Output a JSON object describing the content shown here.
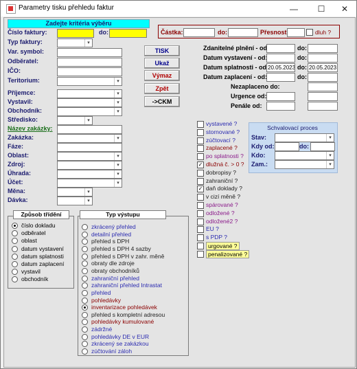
{
  "window": {
    "title": "Parametry tisku přehledu faktur",
    "minimize": "—",
    "maximize": "☐",
    "close": "✕"
  },
  "criteria_header": "Zadejte kritéria výběru",
  "left_fields": {
    "cislo_faktury": "Číslo faktury:",
    "do": "do:",
    "typ_faktury": "Typ faktury:",
    "var_symbol": "Var. symbol:",
    "odberatel": "Odběratel:",
    "ico": "IČO:",
    "teritorium": "Teritorium:",
    "prijemce": "Příjemce:",
    "vystavil": "Vystavil:",
    "obchodnik": "Obchodník:",
    "stredisko": "Středisko:",
    "nazev_zakazky": "Název zakázky:",
    "zakazka": "Zakázka:",
    "faze": "Fáze:",
    "oblast": "Oblast:",
    "zdroj": "Zdroj:",
    "uhrada": "Úhrada:",
    "ucet": "Účet:",
    "mena": "Měna:",
    "davka": "Dávka:"
  },
  "amount": {
    "castka": "Částka:",
    "do": "do:",
    "presnost": "Přesnost:",
    "dluh": "dluh ?"
  },
  "buttons": {
    "tisk": "TISK",
    "ukaz": "Ukaž",
    "vymaz": "Výmaz",
    "zpet": "Zpět",
    "ckm": "->CKM"
  },
  "dates": {
    "zdanitelne": "Zdanitelné plnění - od:",
    "vystaveni": "Datum vystavení - od:",
    "splatnosti": "Datum splatnosti - od:",
    "zaplaceni": "Datum zaplacení - od:",
    "do": "do:",
    "splatnost_od": "20.05.2023",
    "splatnost_do": "20.05.2023",
    "nezaplaceno": "Nezaplaceno do:",
    "urgence": "Urgence od:",
    "penale": "Penále od:"
  },
  "checks": [
    {
      "label": "vystavené ?",
      "checked": false,
      "color": "#2b2bb0"
    },
    {
      "label": "stornované ?",
      "checked": false,
      "color": "#2b2bb0"
    },
    {
      "label": "zúčtovací ?",
      "checked": false,
      "color": "#2b2bb0"
    },
    {
      "label": "zaplacené ?",
      "checked": false,
      "color": "#8b0000"
    },
    {
      "label": "po splatnosti ?",
      "checked": false,
      "color": "#8a1a8a"
    },
    {
      "label": "dlužná č. > 0 ?",
      "checked": true,
      "color": "#8b0000"
    },
    {
      "label": "dobropisy ?",
      "checked": false,
      "color": "#222"
    },
    {
      "label": "zahraniční ?",
      "checked": false,
      "color": "#222"
    },
    {
      "label": "daň doklady ?",
      "checked": true,
      "color": "#222"
    },
    {
      "label": "v cizí měně ?",
      "checked": false,
      "color": "#222"
    },
    {
      "label": "spárované ?",
      "checked": false,
      "color": "#8a1a8a"
    },
    {
      "label": "odložené ?",
      "checked": false,
      "color": "#8a1a8a"
    },
    {
      "label": "odložené2 ?",
      "checked": false,
      "color": "#8a1a8a"
    },
    {
      "label": "EU ?",
      "checked": false,
      "color": "#2b2bb0"
    },
    {
      "label": "s PDP ?",
      "checked": false,
      "color": "#2b2bb0"
    },
    {
      "label": "urgované ?",
      "checked": false,
      "color": "#000"
    },
    {
      "label": "penalizované ?",
      "checked": false,
      "color": "#000"
    }
  ],
  "approval": {
    "title": "Schvalovací proces",
    "stav": "Stav:",
    "kdy_od": "Kdy od:",
    "do": "do:",
    "kdo": "Kdo:",
    "zam": "Zam.:"
  },
  "sort": {
    "title": "Způsob třídění",
    "items": [
      "číslo dokladu",
      "odběratel",
      "oblast",
      "datum vystavení",
      "datum splatnosti",
      "datum zaplacení",
      "vystavil",
      "obchodník"
    ],
    "selected": 0
  },
  "output": {
    "title": "Typ výstupu",
    "items": [
      {
        "label": "zkrácený přehled",
        "color": "#2b2bb0"
      },
      {
        "label": "detailní přehled",
        "color": "#2b2bb0"
      },
      {
        "label": "přehled s DPH",
        "color": "#222"
      },
      {
        "label": "přehled s DPH 4 sazby",
        "color": "#222"
      },
      {
        "label": "přehled s DPH v zahr. měně",
        "color": "#222"
      },
      {
        "label": "obraty dle zdroje",
        "color": "#222"
      },
      {
        "label": "obraty obchodníků",
        "color": "#222"
      },
      {
        "label": "zahraniční přehled",
        "color": "#2b2bb0"
      },
      {
        "label": "zahraniční přehled Intrastat",
        "color": "#2b2bb0"
      },
      {
        "label": "přehled",
        "color": "#2b2bb0"
      },
      {
        "label": "pohledávky",
        "color": "#8b0000"
      },
      {
        "label": "inventarizace pohledávek",
        "color": "#8b0000"
      },
      {
        "label": "přehled s kompletní adresou",
        "color": "#222"
      },
      {
        "label": "pohledávky kumulované",
        "color": "#8b0000"
      },
      {
        "label": "zádržné",
        "color": "#2b2bb0"
      },
      {
        "label": "pohledávky DE v EUR",
        "color": "#2b2bb0"
      },
      {
        "label": "zkrácený se zakázkou",
        "color": "#2b2bb0"
      },
      {
        "label": "zúčtování záloh",
        "color": "#2b2bb0"
      }
    ],
    "selected": 11
  }
}
